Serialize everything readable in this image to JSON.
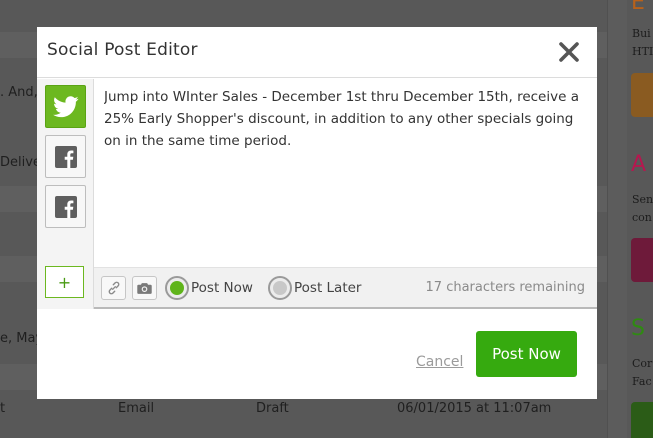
{
  "background": {
    "rows": [
      {
        "text": ". And,"
      },
      {
        "text": "Deliver"
      },
      {
        "text": "e, May"
      },
      {
        "cells": [
          "t",
          "Email",
          "Draft",
          "06/01/2015 at 11:07am"
        ]
      }
    ],
    "sidebar": {
      "sections": [
        {
          "heading": "E",
          "line1": "Bui",
          "line2": "HTI",
          "color": "#b8611a"
        },
        {
          "heading": "A",
          "line1": "Sen",
          "line2": "con",
          "color": "#b5184f"
        },
        {
          "heading": "S",
          "line1": "Cor",
          "line2": "Fac",
          "color": "#2f8a12"
        }
      ]
    }
  },
  "modal": {
    "title": "Social Post Editor",
    "accounts": [
      {
        "network": "twitter",
        "icon": "twitter-icon",
        "active": true
      },
      {
        "network": "facebook",
        "icon": "facebook-icon",
        "active": false
      },
      {
        "network": "facebook",
        "icon": "facebook-icon",
        "active": false
      }
    ],
    "add_label": "+",
    "post_text": "Jump into WInter Sales - December 1st thru December 15th, receive a 25% Early Shopper's discount, in addition to any other specials going on in the same time period.",
    "toolbar": {
      "link_icon": "link-icon",
      "camera_icon": "camera-icon",
      "options": [
        {
          "label": "Post Now",
          "selected": true
        },
        {
          "label": "Post Later",
          "selected": false
        }
      ],
      "chars_remaining": "17 characters remaining"
    },
    "footer": {
      "cancel_label": "Cancel",
      "submit_label": "Post Now"
    }
  },
  "colors": {
    "accent_green": "#36aa0f",
    "twitter_active": "#6cb820",
    "radio_selected": "#5fb41a"
  }
}
